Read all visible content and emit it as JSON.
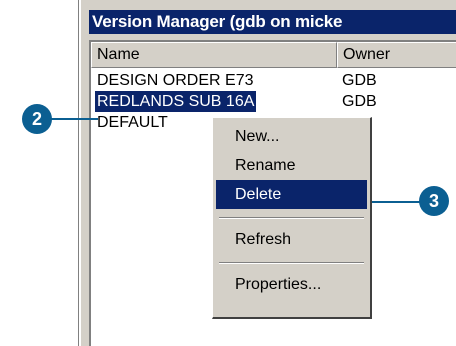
{
  "window": {
    "title": "Version Manager (gdb on micke"
  },
  "list": {
    "columns": [
      "Name",
      "Owner"
    ],
    "rows": [
      {
        "name": "DESIGN ORDER E73",
        "owner": "GDB"
      },
      {
        "name": "REDLANDS SUB 16A",
        "owner": "GDB",
        "selected": true
      },
      {
        "name": "DEFAULT",
        "owner": ""
      }
    ]
  },
  "context_menu": {
    "items": [
      {
        "label": "New..."
      },
      {
        "label": "Rename"
      },
      {
        "label": "Delete",
        "highlighted": true
      },
      {
        "label": "Refresh"
      },
      {
        "label": "Properties..."
      }
    ]
  },
  "callouts": {
    "step_2": "2",
    "step_3": "3",
    "color": "#0b5f92"
  },
  "colors": {
    "selection": "#0a246a",
    "window_face": "#d4d0c8"
  }
}
